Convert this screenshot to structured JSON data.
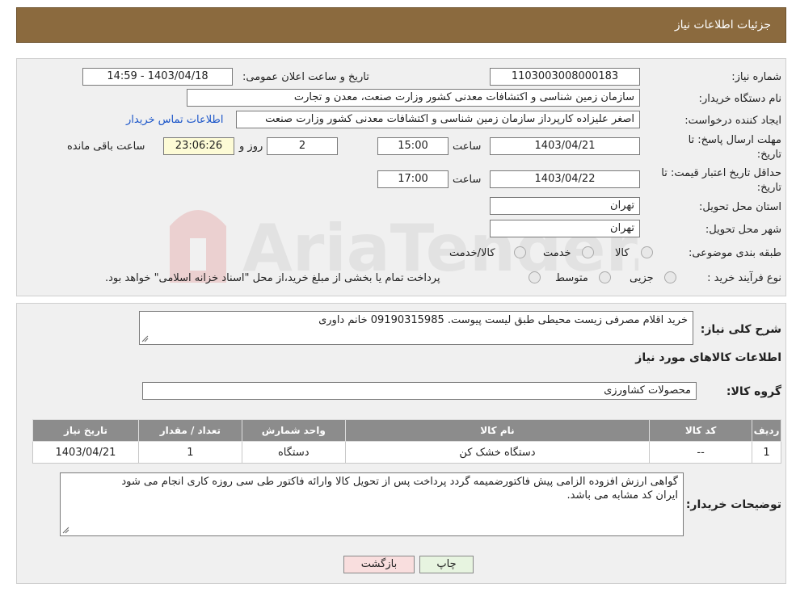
{
  "header": {
    "title": "جزئیات اطلاعات نیاز"
  },
  "form": {
    "need_number_label": "شماره نیاز:",
    "need_number": "1103003008000183",
    "announce_label": "تاریخ و ساعت اعلان عمومی:",
    "announce_value": "1403/04/18 - 14:59",
    "buyer_org_label": "نام دستگاه خریدار:",
    "buyer_org": "سازمان زمین شناسی و اکتشافات معدنی کشور وزارت صنعت، معدن و تجارت",
    "creator_label": "ایجاد کننده درخواست:",
    "creator": "اصغر علیزاده کارپرداز سازمان زمین شناسی و اکتشافات معدنی کشور وزارت صنعت",
    "contact_link": "اطلاعات تماس خریدار",
    "reply_deadline_label_1": "مهلت ارسال پاسخ: تا",
    "reply_deadline_label_2": "تاریخ:",
    "reply_date": "1403/04/21",
    "time_label": "ساعت",
    "reply_time": "15:00",
    "days_value": "2",
    "days_label": "روز و",
    "remaining_time": "23:06:26",
    "remaining_label": "ساعت باقی مانده",
    "price_validity_label_1": "حداقل تاریخ اعتبار قیمت: تا",
    "price_validity_label_2": "تاریخ:",
    "price_date": "1403/04/22",
    "price_time": "17:00",
    "province_label": "استان محل تحویل:",
    "province": "تهران",
    "city_label": "شهر محل تحویل:",
    "city": "تهران",
    "category_label": "طبقه بندی موضوعی:",
    "category_options": [
      "کالا",
      "خدمت",
      "کالا/خدمت"
    ],
    "process_label": "نوع فرآیند خرید :",
    "process_options": [
      "جزیی",
      "متوسط"
    ],
    "process_note": "پرداخت تمام یا بخشی از مبلغ خرید،از محل \"اسناد خزانه اسلامی\" خواهد بود."
  },
  "details": {
    "description_label": "شرح کلی نیاز:",
    "description": "خرید اقلام مصرفی زیست محیطی  طبق لیست پیوست. 09190315985  خانم داوری",
    "items_title": "اطلاعات کالاهای مورد نیاز",
    "group_label": "گروه کالا:",
    "group_value": "محصولات کشاورزی",
    "table": {
      "headers": [
        "ردیف",
        "کد کالا",
        "نام کالا",
        "واحد شمارش",
        "تعداد / مقدار",
        "تاریخ نیاز"
      ],
      "rows": [
        [
          "1",
          "--",
          "دستگاه خشک کن",
          "دستگاه",
          "1",
          "1403/04/21"
        ]
      ]
    },
    "buyer_notes_label": "توضیحات خریدار:",
    "buyer_notes_line1": "گواهی ارزش افزوده الزامی پیش فاکتورضمیمه گردد پرداخت پس از تحویل کالا وارائه فاکتور طی سی روزه کاری انجام می شود",
    "buyer_notes_line2": "ایران کد مشابه می باشد."
  },
  "buttons": {
    "print": "چاپ",
    "back": "بازگشت"
  },
  "colors": {
    "header": "#8b6a3e",
    "link": "#1a55c9",
    "table_header": "#8c8c8c"
  }
}
